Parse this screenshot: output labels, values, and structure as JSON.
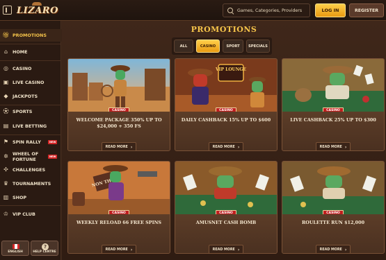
{
  "header": {
    "logo": "LIZARO",
    "search_placeholder": "Games, Categories, Providers",
    "login_label": "LOG IN",
    "register_label": "REGISTER"
  },
  "sidebar": {
    "items": [
      {
        "label": "PROMOTIONS",
        "icon": "gift-icon",
        "active": true
      },
      {
        "label": "HOME",
        "icon": "home-icon"
      },
      {
        "label": "CASINO",
        "icon": "casino-chip-icon"
      },
      {
        "label": "LIVE CASINO",
        "icon": "live-casino-icon"
      },
      {
        "label": "JACKPOTS",
        "icon": "jackpot-icon"
      },
      {
        "label": "SPORTS",
        "icon": "sports-ball-icon"
      },
      {
        "label": "LIVE BETTING",
        "icon": "live-betting-icon"
      },
      {
        "label": "SPIN RALLY",
        "icon": "spin-rally-icon",
        "badge": "NEW"
      },
      {
        "label": "WHEEL OF FORTUNE",
        "icon": "wheel-icon",
        "badge": "NEW"
      },
      {
        "label": "CHALLENGES",
        "icon": "challenges-icon"
      },
      {
        "label": "TOURNAMENTS",
        "icon": "trophy-icon"
      },
      {
        "label": "SHOP",
        "icon": "shop-icon"
      },
      {
        "label": "VIP CLUB",
        "icon": "vip-crown-icon"
      }
    ],
    "language_label": "ENGLISH",
    "help_label": "HELP CENTRE"
  },
  "main": {
    "title": "PROMOTIONS",
    "filters": [
      {
        "label": "ALL"
      },
      {
        "label": "CASINO",
        "active": true
      },
      {
        "label": "SPORT"
      },
      {
        "label": "SPECIALS"
      }
    ],
    "cards": [
      {
        "badge": "CASINO",
        "title": "WELCOME PACKAGE 350% UP TO $24,000 + 350 FS",
        "button": "READ MORE"
      },
      {
        "badge": "CASINO",
        "title": "DAILY CASHBACK 15% UP TO $600",
        "button": "READ MORE",
        "sign": "VIP LOUNGE"
      },
      {
        "badge": "CASINO",
        "title": "LIVE CASHBACK 25% UP TO $300",
        "button": "READ MORE"
      },
      {
        "badge": "CASINO",
        "title": "WEEKLY RELOAD 66 FREE SPINS",
        "button": "READ MORE",
        "sign": "NON THU"
      },
      {
        "badge": "CASINO",
        "title": "AMUSNET CASH BOMB",
        "button": "READ MORE"
      },
      {
        "badge": "CASINO",
        "title": "ROULETTE RUN $12,000",
        "button": "READ MORE"
      }
    ]
  }
}
